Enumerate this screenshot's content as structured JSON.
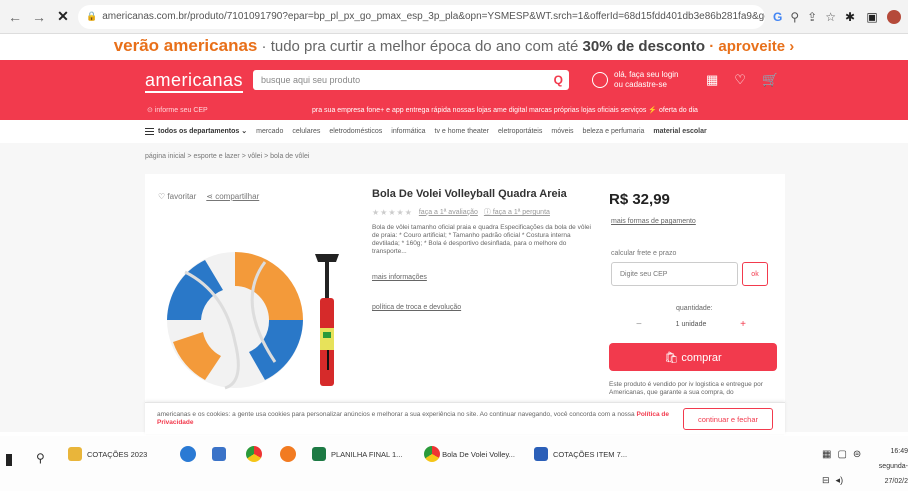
{
  "browser": {
    "url": "americanas.com.br/produto/7101091790?epar=bp_pl_px_go_pmax_esp_3p_pla&opn=YSMESP&WT.srch=1&offerId=68d15fdd401db3e86b281fa9&gc...",
    "close_glyph": "✕"
  },
  "promo": {
    "brand": "verão americanas",
    "text": " · tudo pra curtir a melhor época do ano com até ",
    "discount": "30% de desconto",
    "cta": " · aproveite ›"
  },
  "header": {
    "logo": "americanas",
    "search_placeholder": "busque aqui seu produto",
    "login_line1": "olá, faça seu login",
    "login_line2": "ou cadastre-se",
    "cep": "⊙ informe seu CEP",
    "quicklinks": "pra sua empresa   fone+ e app   entrega rápida   nossas lojas   ame digital   marcas próprias   lojas oficiais   serviços   ⚡ oferta do dia"
  },
  "departments": {
    "toggle": "todos os departamentos",
    "items": [
      "mercado",
      "celulares",
      "eletrodomésticos",
      "informática",
      "tv e home theater",
      "eletroportáteis",
      "móveis",
      "beleza e perfumaria",
      "material escolar"
    ]
  },
  "breadcrumb": "página inicial  >  esporte e lazer  >  vôlei  >  bola de vôlei",
  "actions": {
    "favorite": "♡ favoritar",
    "share": "⋖ compartilhar"
  },
  "product": {
    "title": "Bola De Volei Volleyball Quadra Areia",
    "stars": "★★★★★",
    "review_link": "faça a 1ª avaliação",
    "question_link": "ⓘ faça a 1ª pergunta",
    "description": "Bola de vôlei tamanho oficial praia e quadra Especificações da bola de vôlei de praia: * Couro artificial; * Tamanho padrão oficial * Costura interna devtilada; * 160g; * Bola é desportivo desinflada, para o melhore do transporte...",
    "more_info": "mais informações",
    "policy": "política de troca e devolução"
  },
  "buy_box": {
    "price": "R$ 32,99",
    "payment": "mais formas de pagamento",
    "shipping_label": "calcular frete e prazo",
    "cep_placeholder": "Digite seu CEP",
    "ok": "ok",
    "qty_label": "quantidade:",
    "qty_value": "1 unidade",
    "buy": "🛍 comprar",
    "seller": "Este produto é vendido por iv logistica e entregue por Americanas, que garante a sua compra, do"
  },
  "cookie": {
    "text": "americanas e os cookies: a gente usa cookies para personalizar anúncios e melhorar a sua experiência no site. Ao continuar navegando, você concorda com a nossa",
    "link": "Política de Privacidade",
    "button": "continuar e fechar"
  },
  "taskbar": {
    "apps": [
      "COTAÇÕES 2023",
      "PLANILHA FINAL 1...",
      "Bola De Volei Volley...",
      "COTAÇÕES ITEM 7..."
    ],
    "time": "16:49",
    "day": "segunda-",
    "date": "27/02/2"
  },
  "colors": {
    "brand_red": "#f23a4d",
    "promo_orange": "#e8701a"
  }
}
